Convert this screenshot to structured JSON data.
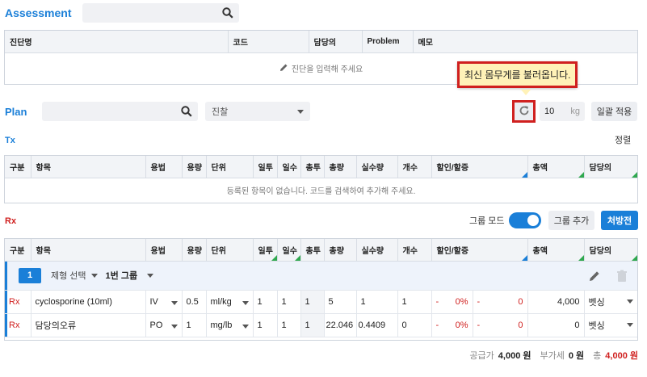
{
  "assessment": {
    "title": "Assessment",
    "search_placeholder": "",
    "columns": [
      "진단명",
      "코드",
      "담당의",
      "Problem",
      "메모"
    ],
    "empty_message": "진단을 입력해 주세요"
  },
  "plan": {
    "title": "Plan",
    "search_placeholder": "",
    "select_value": "진찰",
    "weight_value": "10",
    "weight_unit": "kg",
    "apply_all_label": "일괄 적용",
    "tooltip": "최신 몸무게를 불러옵니다."
  },
  "tx": {
    "title": "Tx",
    "sort_label": "정렬",
    "columns": [
      "구분",
      "항목",
      "용법",
      "용량",
      "단위",
      "일투",
      "일수",
      "총투",
      "총량",
      "실수량",
      "개수",
      "할인/할증",
      "총액",
      "담당의"
    ],
    "empty_message": "등록된 항목이 없습니다. 코드를 검색하여 추가해 주세요."
  },
  "rx": {
    "title": "Rx",
    "group_mode_label": "그룹 모드",
    "group_add_label": "그룹 추가",
    "prescription_label": "처방전",
    "columns": [
      "구분",
      "항목",
      "용법",
      "용량",
      "단위",
      "일투",
      "일수",
      "총투",
      "총량",
      "실수량",
      "개수",
      "할인/할증",
      "총액",
      "담당의"
    ],
    "group": {
      "number": "1",
      "dosage_form": "제형 선택",
      "group_name": "1번 그룹"
    },
    "rows": [
      {
        "type": "Rx",
        "item": "cyclosporine (10ml)",
        "usage": "IV",
        "dose": "0.5",
        "unit": "ml/kg",
        "daily": "1",
        "days": "1",
        "total_doses": "1",
        "total_amount": "5",
        "actual_qty": "1",
        "count": "1",
        "discount_pct": "0%",
        "discount_amt": "0",
        "total": "4,000",
        "doctor": "벳싱"
      },
      {
        "type": "Rx",
        "item": "담당의오류",
        "usage": "PO",
        "dose": "1",
        "unit": "mg/lb",
        "daily": "1",
        "days": "1",
        "total_doses": "1",
        "total_amount": "22.046",
        "actual_qty": "0.4409",
        "count": "0",
        "discount_pct": "0%",
        "discount_amt": "0",
        "total": "0",
        "doctor": "벳싱"
      }
    ]
  },
  "summary": {
    "supply_label": "공급가",
    "supply_value": "4,000 원",
    "vat_label": "부가세",
    "vat_value": "0 원",
    "total_label": "총",
    "total_value": "4,000 원"
  },
  "colors": {
    "accent": "#1a7fd8",
    "danger": "#d0201f",
    "tooltip_bg": "#fff2b8",
    "triangle": "#2fa84f"
  }
}
